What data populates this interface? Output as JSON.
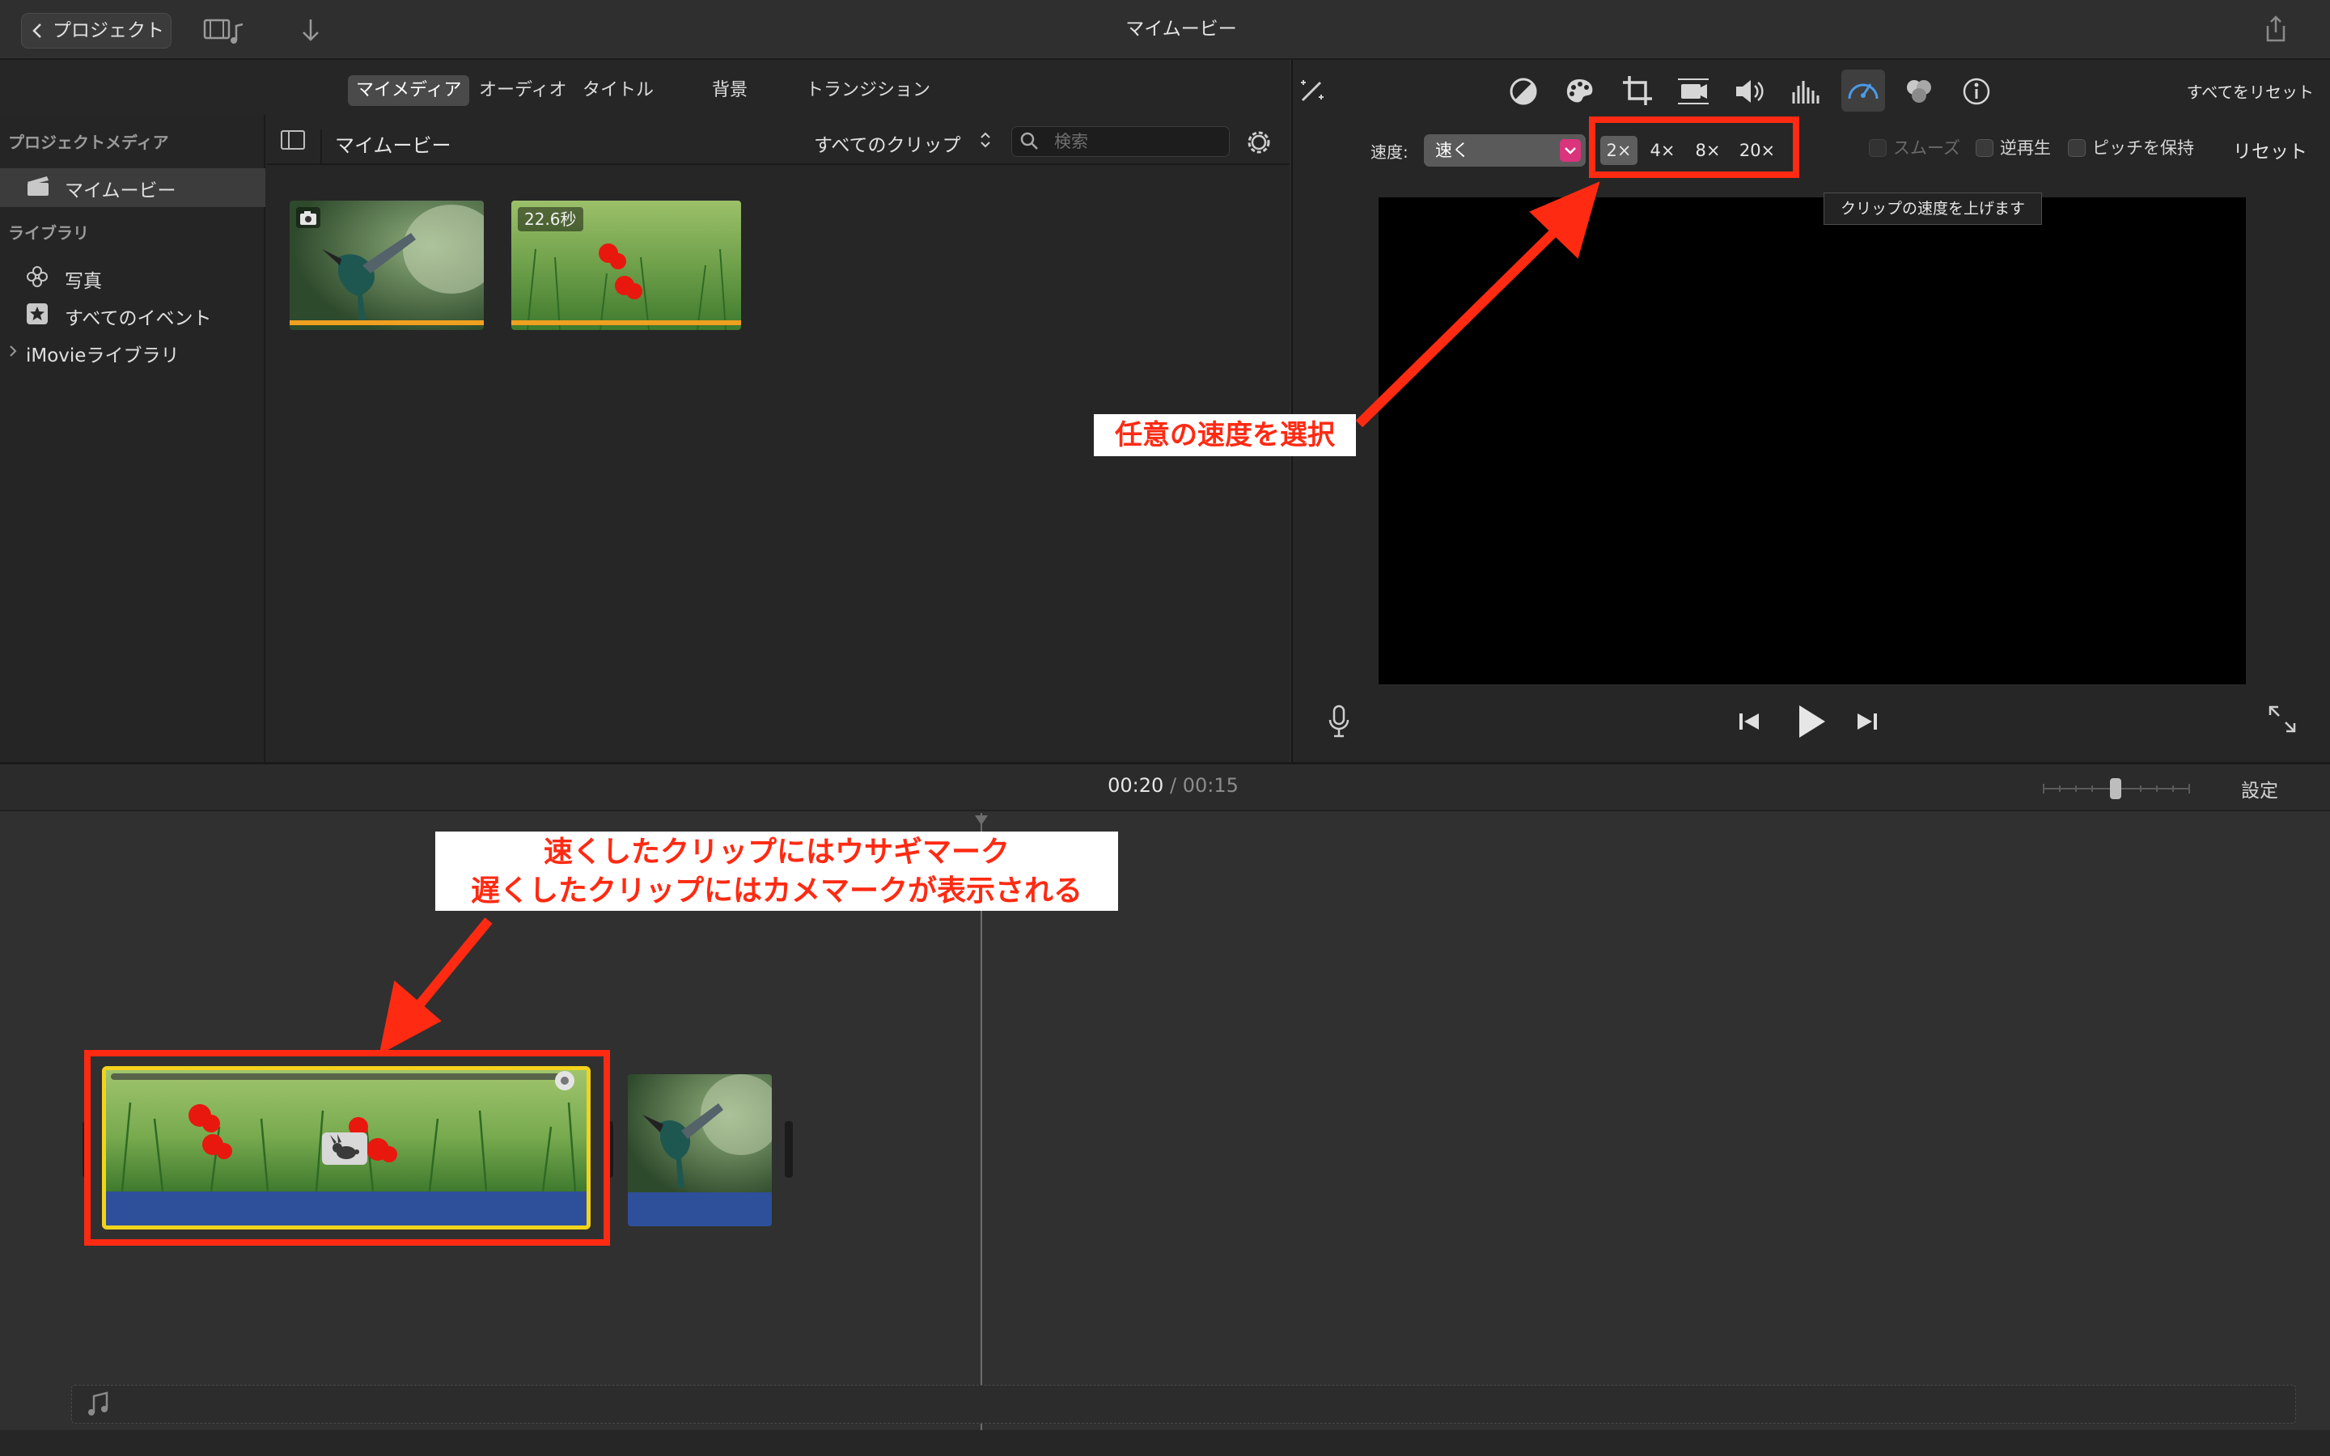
{
  "titlebar": {
    "back_label": "プロジェクト",
    "title": "マイムービー"
  },
  "media_tabs": [
    "マイメディア",
    "オーディオ",
    "タイトル",
    "背景",
    "トランジション"
  ],
  "sidebar": {
    "project_media_heading": "プロジェクトメディア",
    "project_item": "マイムービー",
    "library_heading": "ライブラリ",
    "photos": "写真",
    "all_events": "すべてのイベント",
    "imovie_library": "iMovieライブラリ"
  },
  "browser": {
    "title": "マイムービー",
    "filter": "すべてのクリップ",
    "search_placeholder": "検索",
    "clip2_duration": "22.6秒"
  },
  "viewer": {
    "reset_all": "すべてをリセット",
    "speed_label": "速度:",
    "speed_value": "速く",
    "speed_options": [
      "2×",
      "4×",
      "8×",
      "20×"
    ],
    "active_speed": "2×",
    "smooth": "スムーズ",
    "reverse": "逆再生",
    "keep_pitch": "ピッチを保持",
    "reset": "リセット",
    "tooltip": "クリップの速度を上げます",
    "active_tool": "speedometer-icon"
  },
  "timeline": {
    "current_time": "00:20",
    "separator": "/",
    "total_time": "00:15",
    "settings": "設定"
  },
  "annotations": {
    "speed_select": "任意の速度を選択",
    "clip_note_line1": "速くしたクリップにはウサギマーク",
    "clip_note_line2": "遅くしたクリップにはカメマークが表示される"
  },
  "colors": {
    "annotation_red": "#ff2a12",
    "clip_selection_yellow": "#f2d31b",
    "audio_blue": "#2e4f9a",
    "speed_select_accent": "#d9347c",
    "clip_strip_orange": "#f0a020"
  }
}
